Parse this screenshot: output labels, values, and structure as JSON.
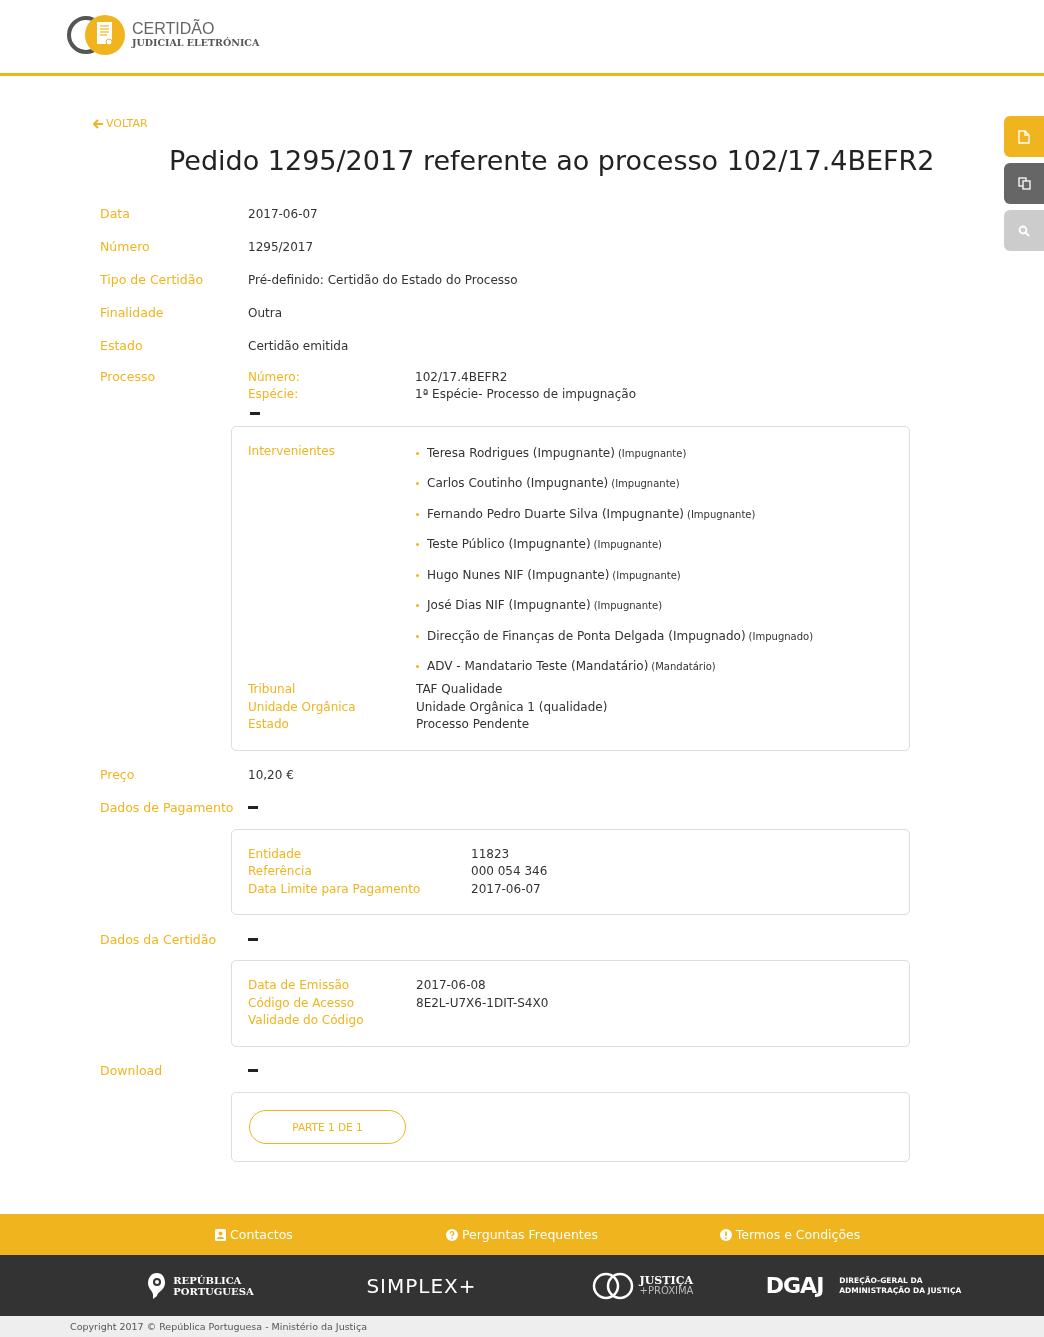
{
  "header": {
    "logo_title": "CERTIDÃO",
    "logo_subtitle": "JUDICIAL ELETRÓNICA"
  },
  "side_buttons": [
    {
      "kind": "document"
    },
    {
      "kind": "copy"
    },
    {
      "kind": "search"
    }
  ],
  "back_link": "VOLTAR",
  "title": "Pedido 1295/2017 referente ao processo 102/17.4BEFR2",
  "fields": [
    {
      "label": "Data",
      "value": "2017-06-07"
    },
    {
      "label": "Número",
      "value": "1295/2017"
    },
    {
      "label": "Tipo de Certidão",
      "value": "Pré-definido: Certidão do Estado do Processo"
    },
    {
      "label": "Finalidade",
      "value": "Outra"
    },
    {
      "label": "Estado",
      "value": "Certidão emitida"
    }
  ],
  "processo": {
    "label": "Processo",
    "items": [
      {
        "label": "Número:",
        "value": "102/17.4BEFR2"
      },
      {
        "label": "Espécie:",
        "value": "1ª Espécie- Processo de impugnação"
      }
    ],
    "expanded": true,
    "intervenientes_label": "Intervenientes",
    "intervenientes": [
      {
        "name": "Teresa Rodrigues (Impugnante)",
        "role": "(Impugnante)"
      },
      {
        "name": "Carlos Coutinho (Impugnante)",
        "role": "(Impugnante)"
      },
      {
        "name": "Fernando Pedro Duarte Silva (Impugnante)",
        "role": "(Impugnante)"
      },
      {
        "name": "Teste Público (Impugnante)",
        "role": "(Impugnante)"
      },
      {
        "name": "Hugo Nunes NIF (Impugnante)",
        "role": "(Impugnante)"
      },
      {
        "name": "José Dias NIF (Impugnante)",
        "role": "(Impugnante)"
      },
      {
        "name": "Direcção de Finanças de Ponta Delgada (Impugnado)",
        "role": "(Impugnado)"
      },
      {
        "name": "ADV - Mandatario Teste (Mandatário)",
        "role": "(Mandatário)"
      }
    ],
    "details": [
      {
        "label": "Tribunal",
        "value": "TAF Qualidade"
      },
      {
        "label": "Unidade Orgânica",
        "value": "Unidade Orgânica 1 (qualidade)"
      },
      {
        "label": "Estado",
        "value": "Processo Pendente"
      }
    ]
  },
  "preco": {
    "label": "Preço",
    "value": "10,20 €"
  },
  "pagamento": {
    "label": "Dados de Pagamento",
    "expanded": true,
    "items": [
      {
        "label": "Entidade",
        "value": "11823"
      },
      {
        "label": "Referência",
        "value": "000 054 346"
      },
      {
        "label": "Data Limite para Pagamento",
        "value": "2017-06-07"
      }
    ]
  },
  "certidao": {
    "label": "Dados da Certidão",
    "expanded": true,
    "items": [
      {
        "label": "Data de Emissão",
        "value": "2017-06-08"
      },
      {
        "label": "Código de Acesso",
        "value": "8E2L-U7X6-1DIT-S4X0"
      },
      {
        "label": "Validade do Código"
      }
    ]
  },
  "download": {
    "label": "Download",
    "expanded": true,
    "button": "PARTE 1 DE 1"
  },
  "footer_links": [
    {
      "kind": "contact",
      "label": "Contactos"
    },
    {
      "kind": "question",
      "label": "Perguntas Frequentes"
    },
    {
      "kind": "info",
      "label": "Termos e Condições"
    }
  ],
  "footer_logos": {
    "republica": [
      "REPÚBLICA",
      "PORTUGUESA"
    ],
    "simplex": "SIMPLEX+",
    "justica": [
      "JUSTIÇA",
      "+PRÓXIMA"
    ],
    "dgaj": "DGAJ",
    "dgaj_name": [
      "DIREÇÃO-GERAL DA",
      "ADMINISTRAÇÃO DA JUSTIÇA"
    ]
  },
  "copyright": "Copyright 2017 © República Portuguesa - Ministério da Justiça"
}
